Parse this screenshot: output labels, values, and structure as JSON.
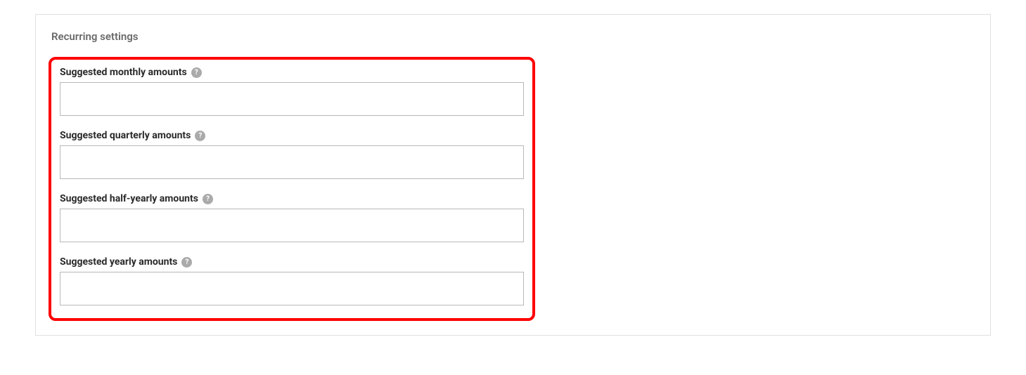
{
  "panel": {
    "title": "Recurring settings"
  },
  "fields": {
    "monthly": {
      "label": "Suggested monthly amounts",
      "value": ""
    },
    "quarterly": {
      "label": "Suggested quarterly amounts",
      "value": ""
    },
    "halfyearly": {
      "label": "Suggested half-yearly amounts",
      "value": ""
    },
    "yearly": {
      "label": "Suggested yearly amounts",
      "value": ""
    }
  },
  "help_icon_text": "?"
}
